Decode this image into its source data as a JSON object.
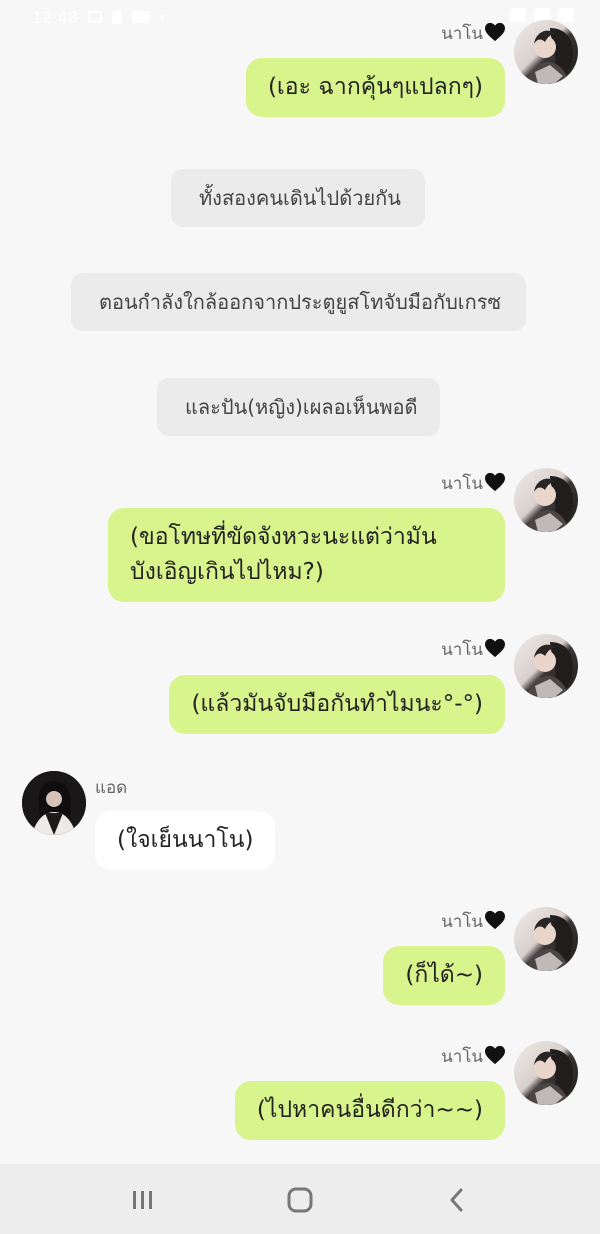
{
  "status_bar": {
    "time": "12:48"
  },
  "messages": [
    {
      "sender": "นาโน",
      "text": "(เอะ ฉากคุ้นๆแปลกๆ)"
    },
    {
      "system": "ทั้งสองคนเดินไปด้วยกัน"
    },
    {
      "system": "ตอนกำลังใกล้ออกจากประตูยูสโทจับมือกับเกรซ"
    },
    {
      "system": "และปัน(หญิง)เผลอเห็นพอดี"
    },
    {
      "sender": "นาโน",
      "text_lines": [
        "(ขอโทษที่ขัดจังหวะนะแต่ว่ามัน",
        "บังเอิญเกินไปไหม?)"
      ]
    },
    {
      "sender": "นาโน",
      "text": "(แล้วมันจับมือกันทำไมนะ°-°)"
    },
    {
      "sender": "แอด",
      "text": "(ใจเย็นนาโน)"
    },
    {
      "sender": "นาโน",
      "text": "(ก็ได้~)"
    },
    {
      "sender": "นาโน",
      "text": "(ไปหาคนอื่นดีกว่า~~)"
    }
  ],
  "nav": {
    "recent_icon": "recent-apps-icon",
    "home_icon": "home-icon",
    "back_icon": "back-icon"
  },
  "colors": {
    "my_bubble": "#d8f48d",
    "other_bubble": "#ffffff",
    "system_bubble": "#ebebeb",
    "background": "#f7f7f7"
  }
}
